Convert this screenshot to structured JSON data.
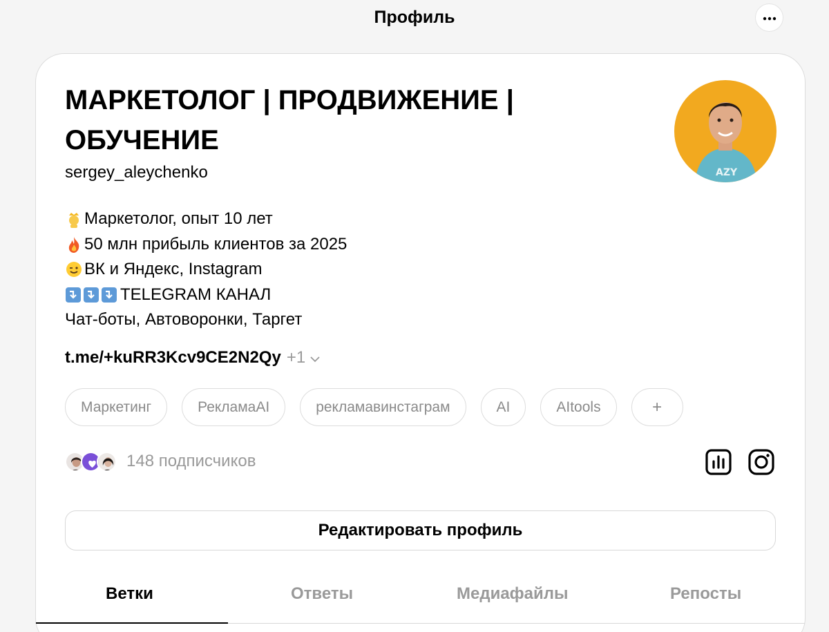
{
  "header": {
    "title": "Профиль",
    "more_icon": "ellipsis-icon"
  },
  "profile": {
    "name": "МАРКЕТОЛОГ | ПРОДВИЖЕНИЕ | ОБУЧЕНИЕ",
    "username": "sergey_aleychenko",
    "bio": [
      {
        "icon": "crown-person-emoji",
        "text": "Маркетолог, опыт 10 лет"
      },
      {
        "icon": "fire-emoji",
        "text": "50 млн прибыль клиентов за 2025"
      },
      {
        "icon": "wink-emoji",
        "text": " ВК и Яндекс, Instagram"
      },
      {
        "icon": "arrow-down-emoji-x3",
        "text": "TELEGRAM КАНАЛ"
      },
      {
        "icon": "",
        "text": "Чат-боты, Автоворонки, Таргет"
      }
    ],
    "link": "t.me/+kuRR3Kcv9CE2N2Qy",
    "link_more": "+1",
    "tags": [
      "Маркетинг",
      "РекламаAI",
      "рекламавинстаграм",
      "AI",
      "AItools"
    ],
    "add_tag": "+",
    "followers_text": "148 подписчиков",
    "edit_button": "Редактировать профиль"
  },
  "tabs": [
    {
      "label": "Ветки",
      "active": true
    },
    {
      "label": "Ответы",
      "active": false
    },
    {
      "label": "Медиафайлы",
      "active": false
    },
    {
      "label": "Репосты",
      "active": false
    }
  ],
  "colors": {
    "background": "#f5f5f5",
    "card": "#ffffff",
    "muted_text": "#999999",
    "border": "#dcdcdc",
    "avatar_bg": "#f2a91f"
  }
}
